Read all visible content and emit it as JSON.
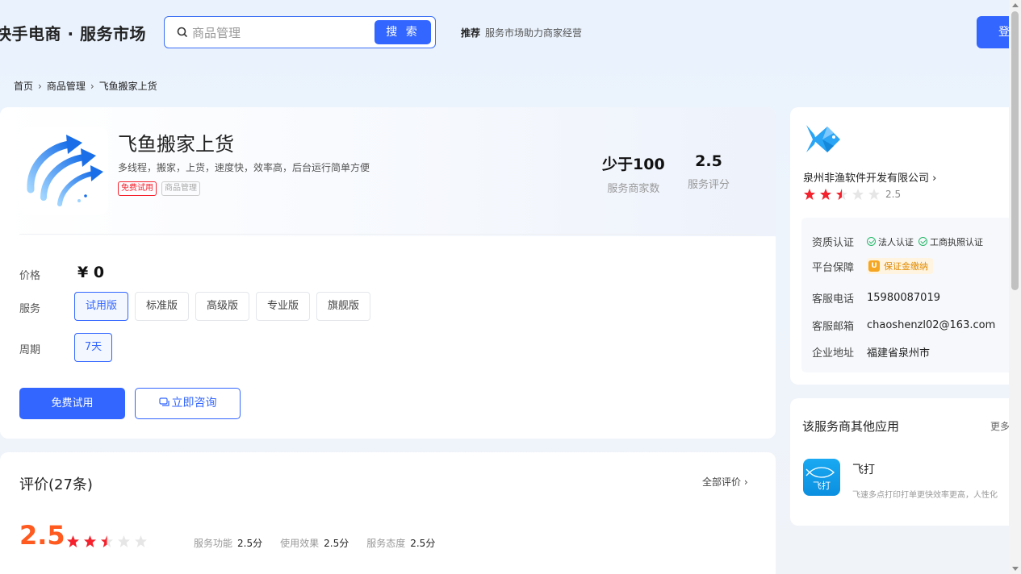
{
  "header": {
    "brand": "快手电商 · 服务市场",
    "search_value": "商品管理",
    "search_button": "搜 索",
    "recommend_label": "推荐",
    "recommend_text": "服务市场助力商家经营",
    "login_label": "登录"
  },
  "breadcrumb": [
    "首页",
    "商品管理",
    "飞鱼搬家上货"
  ],
  "breadcrumb_sep": "›",
  "product": {
    "title": "飞鱼搬家上货",
    "description": "多线程，搬家，上货，速度快，效率高，后台运行简单方便",
    "tags": [
      "免费试用",
      "商品管理"
    ],
    "stats": [
      {
        "value": "少于100",
        "label": "服务商家数"
      },
      {
        "value": "2.5",
        "label": "服务评分"
      }
    ],
    "price_label": "价格",
    "price_value": "¥ 0",
    "service_label": "服务",
    "service_options": [
      "试用版",
      "标准版",
      "高级版",
      "专业版",
      "旗舰版"
    ],
    "service_selected": "试用版",
    "period_label": "周期",
    "period_options": [
      "7天"
    ],
    "period_selected": "7天",
    "trial_button": "免费试用",
    "consult_button": "立即咨询"
  },
  "reviews": {
    "title": "评价(27条)",
    "all_link": "全部评价 ›",
    "score": "2.5",
    "rating": 2.5,
    "rating_max": 5,
    "dims": [
      {
        "label": "服务功能",
        "value": "2.5分"
      },
      {
        "label": "使用效果",
        "value": "2.5分"
      },
      {
        "label": "服务态度",
        "value": "2.5分"
      }
    ]
  },
  "vendor": {
    "name": "泉州非渔软件开发有限公司 ›",
    "rating": 2.5,
    "rating_text": "2.5",
    "qual_label": "资质认证",
    "certs": [
      "法人认证",
      "工商执照认证"
    ],
    "guarantee_label": "平台保障",
    "guarantee_badge": "保证金缴纳",
    "phone_label": "客服电话",
    "phone": "15980087019",
    "email_label": "客服邮箱",
    "email": "chaoshenzl02@163.com",
    "address_label": "企业地址",
    "address": "福建省泉州市"
  },
  "other_apps": {
    "title": "该服务商其他应用",
    "more": "更多",
    "items": [
      {
        "name": "飞打",
        "icon_text": "飞打",
        "desc": "飞速多点打印打单更快效率更高，人性化"
      }
    ]
  },
  "colors": {
    "primary": "#3366ff",
    "score_orange": "#ff5a1f",
    "star_red": "#f5222d",
    "star_empty": "#e6e6e6",
    "cert_green": "#28b86a"
  }
}
